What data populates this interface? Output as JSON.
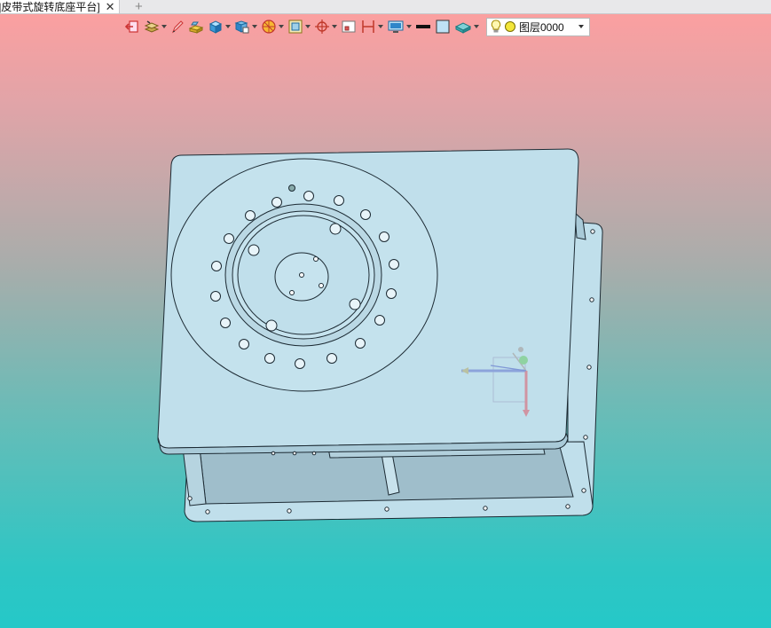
{
  "tab": {
    "title": "]皮带式旋转底座平台]",
    "close_glyph": "✕",
    "new_glyph": "+"
  },
  "toolbar": {
    "buttons": [
      {
        "icon": "exit-sketch-icon"
      },
      {
        "icon": "layers-stack-icon"
      },
      {
        "icon": "pencil-icon"
      },
      {
        "icon": "extrude-box-icon"
      },
      {
        "icon": "shaded-cube-icon"
      },
      {
        "icon": "view-orientation-icon"
      },
      {
        "icon": "render-style-icon"
      },
      {
        "icon": "section-view-icon"
      },
      {
        "icon": "snap-target-icon"
      },
      {
        "icon": "frame-icon"
      },
      {
        "icon": "dimension-icon"
      },
      {
        "icon": "display-settings-icon"
      },
      {
        "icon": "line-color-icon"
      },
      {
        "icon": "fill-color-icon"
      },
      {
        "icon": "material-icon"
      }
    ],
    "layer": {
      "label": "图层0000",
      "bulb": "lightbulb-icon",
      "state": "circle-icon"
    }
  },
  "colors": {
    "bg_top": "#ff9f9f",
    "bg_bottom": "#25c8c8",
    "part_face": "#c0dfeb",
    "part_edge": "#1c2a33",
    "part_dark": "#9fbecb"
  }
}
